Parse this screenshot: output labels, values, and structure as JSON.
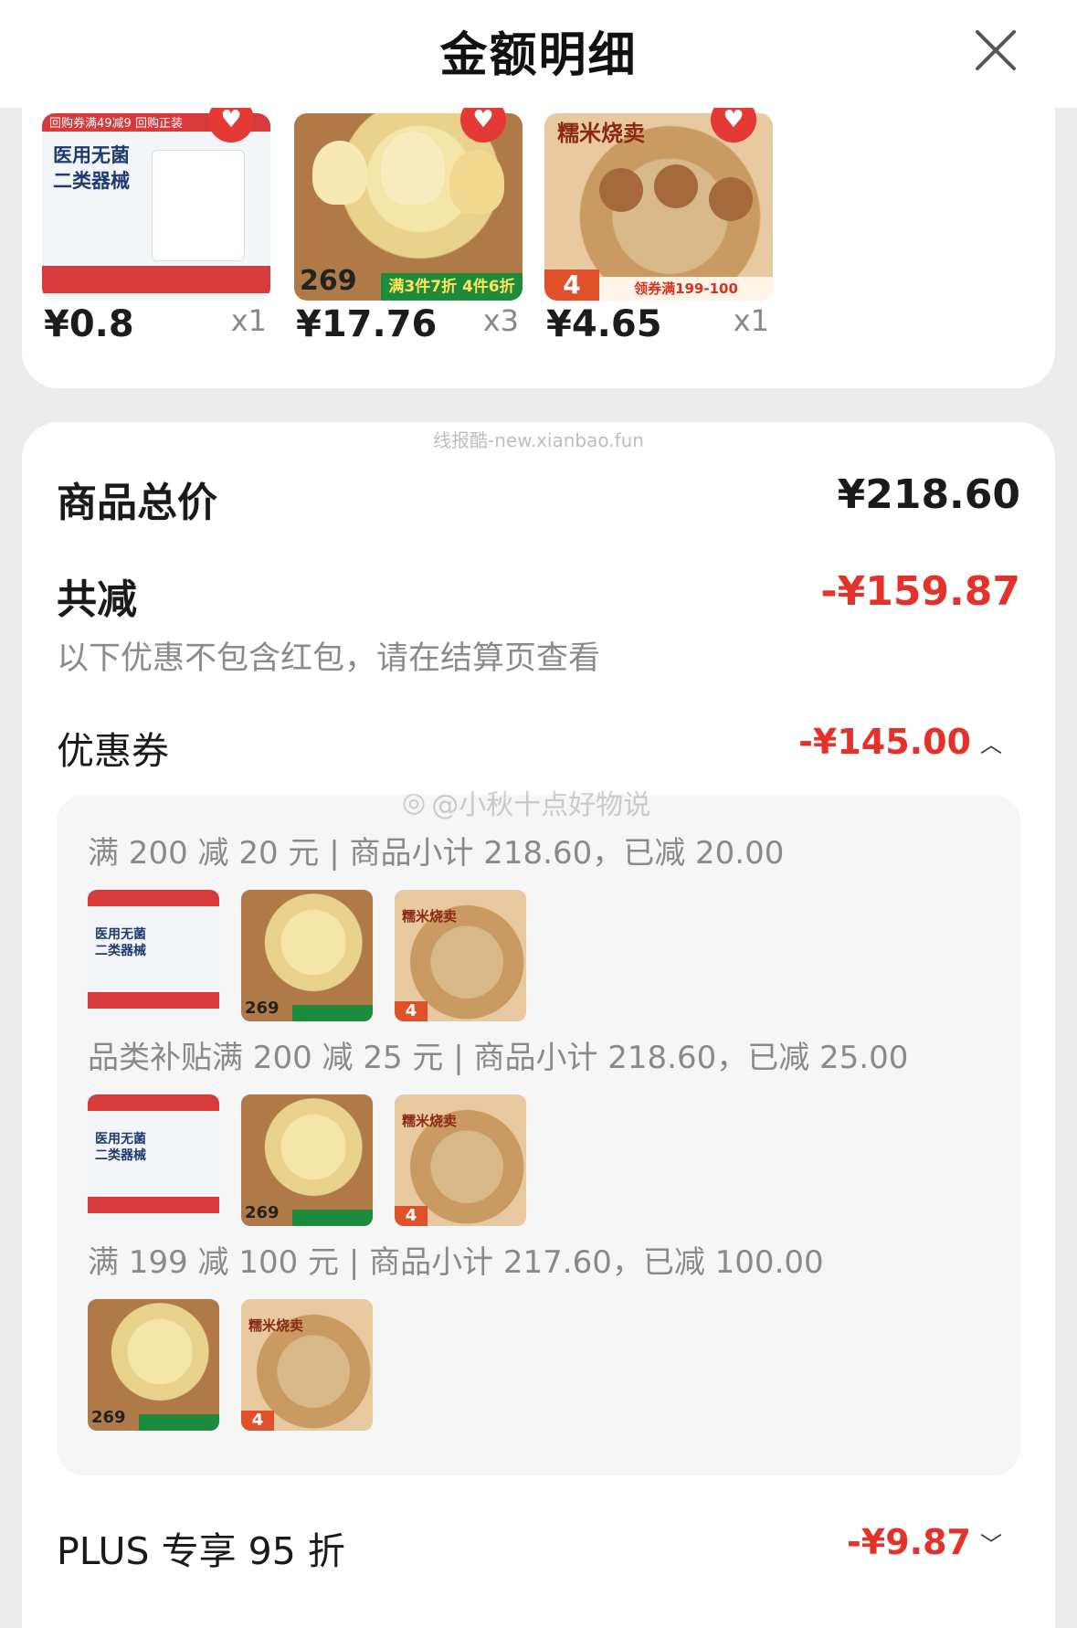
{
  "header": {
    "title": "金额明细"
  },
  "products": [
    {
      "price": "¥0.8",
      "qty": "x1",
      "thumb": "mask"
    },
    {
      "price": "¥17.76",
      "qty": "x3",
      "thumb": "wonton"
    },
    {
      "price": "¥4.65",
      "qty": "x1",
      "thumb": "shaomai"
    }
  ],
  "thumb_text": {
    "mask_lines": [
      "医用无菌",
      "二类器械"
    ],
    "mask_top": "回购券满49减9 回购正装",
    "wonton_price": "269",
    "wonton_banner": "满3件7折 4件6折",
    "shaomai_title": "糯米烧卖",
    "shaomai_banner": "领券满199-100",
    "shaomai_four": "4"
  },
  "watermark_top": "线报酷-new.xianbao.fun",
  "summary": {
    "total_label": "商品总价",
    "total_value": "¥218.60",
    "discount_label": "共减",
    "discount_value": "-¥159.87",
    "note": "以下优惠不包含红包，请在结算页查看"
  },
  "coupons": {
    "label": "优惠券",
    "value": "-¥145.00",
    "items": [
      {
        "text": "满 200 减 20 元 | 商品小计 218.60，已减 20.00",
        "thumbs": [
          "mask",
          "wonton",
          "shaomai"
        ]
      },
      {
        "text": "品类补贴满 200 减 25 元 | 商品小计 218.60，已减 25.00",
        "thumbs": [
          "mask",
          "wonton",
          "shaomai"
        ]
      },
      {
        "text": "满 199 减 100 元 | 商品小计 217.60，已减 100.00",
        "thumbs": [
          "wonton",
          "shaomai"
        ]
      }
    ]
  },
  "weibo_watermark": "@小秋十点好物说",
  "plus": {
    "label": "PLUS 专享 95 折",
    "value": "-¥9.87"
  },
  "colors": {
    "accent_red": "#e4322a",
    "text_gray": "#8a8a8a"
  }
}
